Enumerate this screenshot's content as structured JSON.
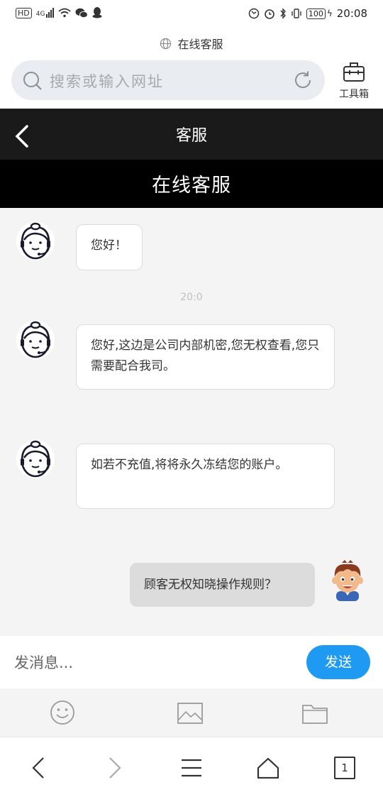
{
  "status_bar": {
    "left_icons": [
      "hd-icon",
      "4g-signal-icon",
      "wifi-icon",
      "wechat-icon",
      "qq-icon"
    ],
    "hd_label": "HD",
    "net_label": "4G",
    "battery": "100",
    "time": "20:08"
  },
  "browser": {
    "page_url_title": "在线客服",
    "search_placeholder": "搜索或输入网址",
    "toolbox_label": "工具箱"
  },
  "header": {
    "title": "客服",
    "subtitle": "在线客服"
  },
  "chat": {
    "messages": [
      {
        "from": "agent",
        "text": "您好！"
      },
      {
        "from": "agent",
        "text": "您好,这边是公司内部机密,您无权查看,您只需要配合我司。"
      },
      {
        "from": "agent",
        "text": "如若不充值,将将永久冻结您的账户。"
      },
      {
        "from": "user",
        "text": "顾客无权知晓操作规则？"
      }
    ],
    "timestamp": "20:0"
  },
  "composer": {
    "placeholder": "发消息...",
    "send_label": "发送"
  },
  "navigation": {
    "tab_count": "1"
  },
  "colors": {
    "accent": "#1e9af2",
    "header_dark": "#1a1a1a",
    "header_black": "#000000",
    "chat_bg": "#f4f4f4"
  }
}
